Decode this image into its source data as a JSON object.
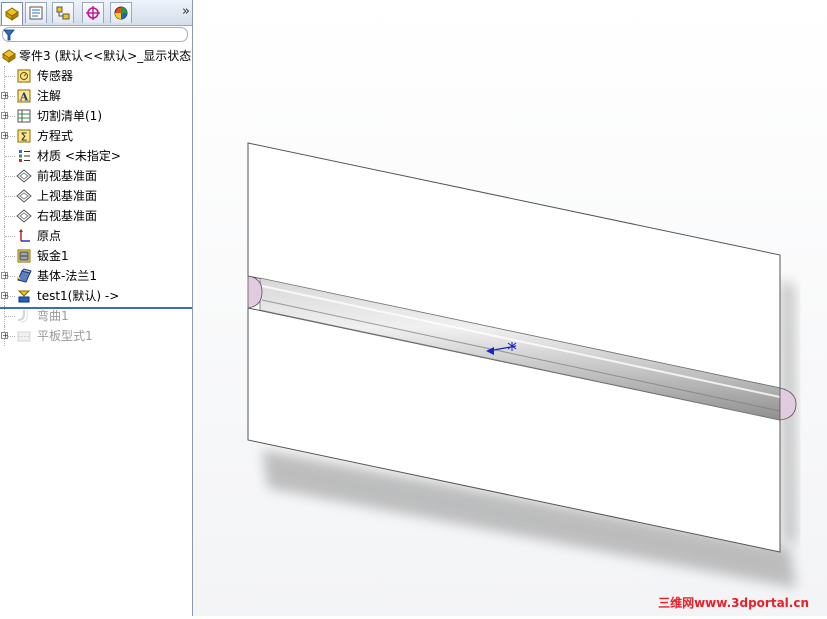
{
  "feature_tree": {
    "tabs": [
      {
        "name": "featuremanager-tab-icon"
      },
      {
        "name": "propertymanager-tab-icon"
      },
      {
        "name": "configurationmanager-tab-icon"
      },
      {
        "name": "dimxpert-tab-icon"
      },
      {
        "name": "display-manager-tab-icon"
      }
    ],
    "more_label": "»",
    "filter_placeholder": "",
    "items": [
      {
        "label": "零件3 (默认<<默认>_显示状态",
        "icon": "part-icon",
        "expander": false,
        "grey": false
      },
      {
        "label": "传感器",
        "icon": "sensor-icon",
        "expander": false,
        "grey": false
      },
      {
        "label": "注解",
        "icon": "annotation-icon",
        "expander": true,
        "grey": false
      },
      {
        "label": "切割清单(1)",
        "icon": "cutlist-icon",
        "expander": true,
        "grey": false
      },
      {
        "label": "方程式",
        "icon": "equation-icon",
        "expander": true,
        "grey": false
      },
      {
        "label": "材质 <未指定>",
        "icon": "material-icon",
        "expander": false,
        "grey": false
      },
      {
        "label": "前视基准面",
        "icon": "plane-icon",
        "expander": false,
        "grey": false
      },
      {
        "label": "上视基准面",
        "icon": "plane-icon",
        "expander": false,
        "grey": false
      },
      {
        "label": "右视基准面",
        "icon": "plane-icon",
        "expander": false,
        "grey": false
      },
      {
        "label": "原点",
        "icon": "origin-icon",
        "expander": false,
        "grey": false
      },
      {
        "label": "钣金1",
        "icon": "sheetmetal-icon",
        "expander": false,
        "grey": false
      },
      {
        "label": "基体-法兰1",
        "icon": "base-flange-icon",
        "expander": true,
        "grey": false
      },
      {
        "label": "test1(默认) ->",
        "icon": "library-feature-icon",
        "expander": true,
        "grey": false
      },
      {
        "label": "弯曲1",
        "icon": "bend-icon",
        "expander": false,
        "grey": true
      },
      {
        "label": "平板型式1",
        "icon": "flat-pattern-icon",
        "expander": true,
        "grey": true
      }
    ]
  },
  "watermark": "三维网www.3dportal.cn",
  "colors": {
    "panel_border": "#8c9aab",
    "rollback_bar": "#3a6fb8",
    "sheet_fill": "#ffffff",
    "groove_fill": "#c9c9c9",
    "groove_end": "#e0c8dc",
    "shadow": "#9a9a9a"
  }
}
